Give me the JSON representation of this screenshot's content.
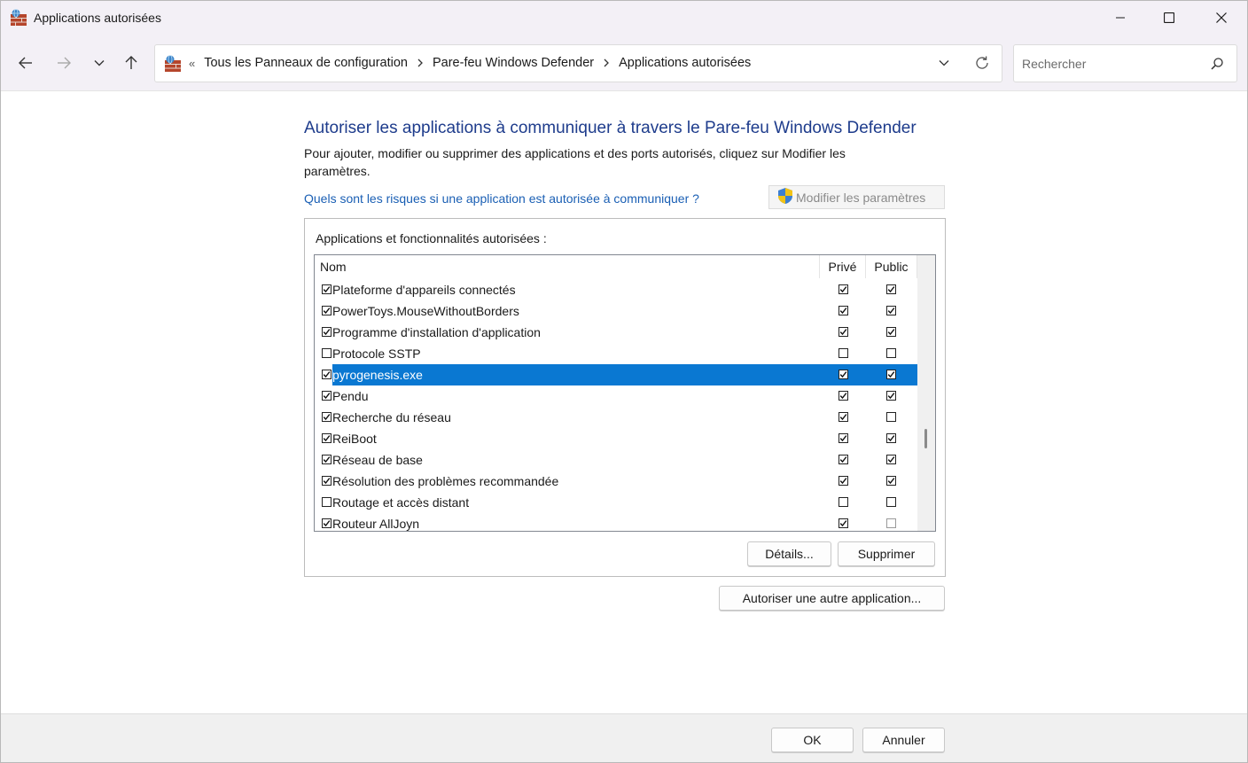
{
  "window": {
    "title": "Applications autorisées"
  },
  "navbar": {
    "breadcrumb_lead": "«",
    "breadcrumbs": [
      "Tous les Panneaux de configuration",
      "Pare-feu Windows Defender",
      "Applications autorisées"
    ],
    "search_placeholder": "Rechercher"
  },
  "main": {
    "heading": "Autoriser les applications à communiquer à travers le Pare-feu Windows Defender",
    "description": "Pour ajouter, modifier ou supprimer des applications et des ports autorisés, cliquez sur Modifier les paramètres.",
    "risk_link": "Quels sont les risques si une application est autorisée à communiquer ?",
    "modify_button": "Modifier les paramètres",
    "group_label": "Applications et fonctionnalités autorisées :",
    "columns": {
      "name": "Nom",
      "private": "Privé",
      "public": "Public"
    },
    "rows": [
      {
        "name": "Plateforme d'appareils connectés",
        "enabled": true,
        "private": true,
        "public": true
      },
      {
        "name": "PowerToys.MouseWithoutBorders",
        "enabled": true,
        "private": true,
        "public": true
      },
      {
        "name": "Programme d'installation d'application",
        "enabled": true,
        "private": true,
        "public": true
      },
      {
        "name": "Protocole SSTP",
        "enabled": false,
        "private": false,
        "public": false
      },
      {
        "name": "pyrogenesis.exe",
        "enabled": true,
        "private": true,
        "public": true,
        "selected": true
      },
      {
        "name": "Pendu",
        "enabled": true,
        "private": true,
        "public": true
      },
      {
        "name": "Recherche du réseau",
        "enabled": true,
        "private": true,
        "public": false
      },
      {
        "name": "ReiBoot",
        "enabled": true,
        "private": true,
        "public": true
      },
      {
        "name": "Réseau de base",
        "enabled": true,
        "private": true,
        "public": true
      },
      {
        "name": "Résolution des problèmes recommandée",
        "enabled": true,
        "private": true,
        "public": true
      },
      {
        "name": "Routage et accès distant",
        "enabled": false,
        "private": false,
        "public": false
      },
      {
        "name": "Routeur AllJoyn",
        "enabled": true,
        "private": true,
        "public": false,
        "public_disabled": true
      }
    ],
    "details_button": "Détails...",
    "remove_button": "Supprimer",
    "allow_other_button": "Autoriser une autre application..."
  },
  "footer": {
    "ok_button": "OK",
    "cancel_button": "Annuler"
  },
  "colors": {
    "heading": "#1e3c8c",
    "link": "#1a5fb4",
    "selection": "#0a78d2"
  },
  "icons": {
    "app": "firewall-brick-icon",
    "shield": "uac-shield-icon"
  }
}
